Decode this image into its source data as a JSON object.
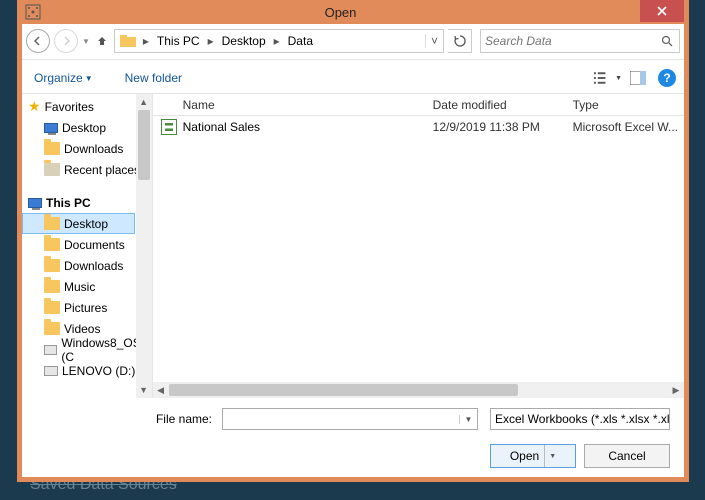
{
  "background_text": "Saved Data Sources",
  "title": "Open",
  "breadcrumb": {
    "seg1": "This PC",
    "seg2": "Desktop",
    "seg3": "Data"
  },
  "search": {
    "placeholder": "Search Data"
  },
  "toolbar": {
    "organize": "Organize",
    "newfolder": "New folder"
  },
  "tree": {
    "favorites": "Favorites",
    "desktop": "Desktop",
    "downloads": "Downloads",
    "recent": "Recent places",
    "thispc": "This PC",
    "pc_desktop": "Desktop",
    "pc_documents": "Documents",
    "pc_downloads": "Downloads",
    "pc_music": "Music",
    "pc_pictures": "Pictures",
    "pc_videos": "Videos",
    "pc_win8": "Windows8_OS (C",
    "pc_lenovo": "LENOVO (D:)"
  },
  "columns": {
    "name": "Name",
    "date": "Date modified",
    "type": "Type"
  },
  "files": {
    "row0": {
      "name": "National Sales",
      "date": "12/9/2019 11:38 PM",
      "type": "Microsoft Excel W..."
    }
  },
  "footer": {
    "filename_label": "File name:",
    "filename_value": "",
    "filter": "Excel Workbooks (*.xls *.xlsx *.xl",
    "open": "Open",
    "cancel": "Cancel"
  }
}
